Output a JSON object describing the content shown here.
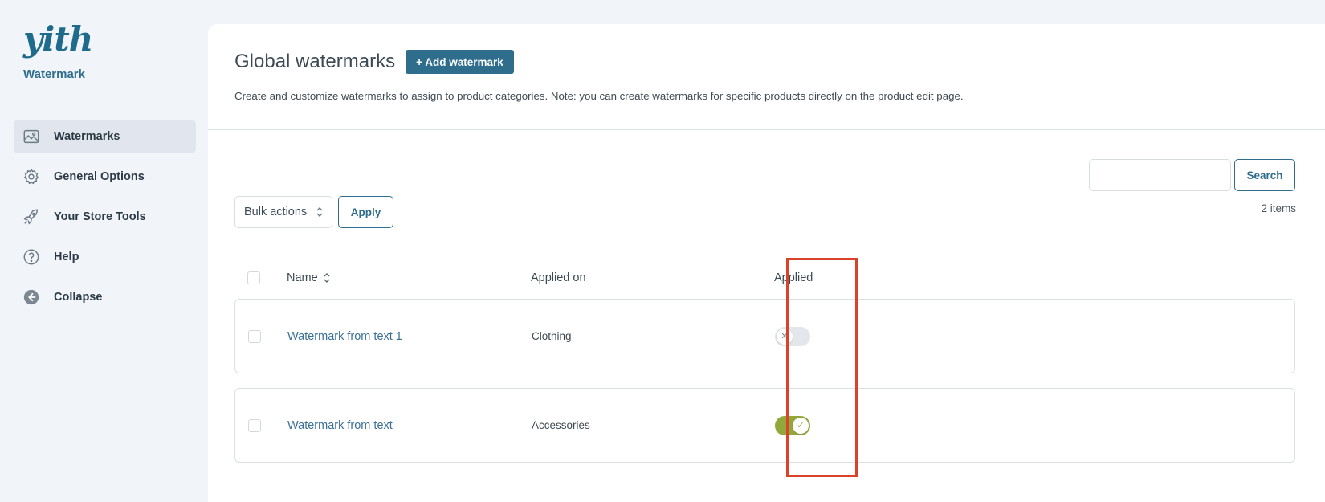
{
  "brand": {
    "logo_text": "yith",
    "subtitle": "Watermark"
  },
  "sidebar": {
    "items": [
      {
        "label": "Watermarks",
        "icon": "image-icon",
        "active": true
      },
      {
        "label": "General Options",
        "icon": "gear-icon",
        "active": false
      },
      {
        "label": "Your Store Tools",
        "icon": "rocket-icon",
        "active": false
      },
      {
        "label": "Help",
        "icon": "help-icon",
        "active": false
      },
      {
        "label": "Collapse",
        "icon": "collapse-icon",
        "active": false
      }
    ]
  },
  "header": {
    "title": "Global watermarks",
    "add_button": "+ Add watermark",
    "description": "Create and customize watermarks to assign to product categories. Note: you can create watermarks for specific products directly on the product edit page."
  },
  "search": {
    "value": "",
    "button": "Search"
  },
  "items_count": "2 items",
  "bulk": {
    "selected": "Bulk actions",
    "apply": "Apply"
  },
  "table": {
    "columns": {
      "name": "Name",
      "applied_on": "Applied on",
      "applied": "Applied"
    },
    "rows": [
      {
        "name": "Watermark from text 1",
        "applied_on": "Clothing",
        "applied": false
      },
      {
        "name": "Watermark from text",
        "applied_on": "Accessories",
        "applied": true
      }
    ]
  },
  "colors": {
    "accent": "#2e6d8c",
    "toggle_on": "#93a83b",
    "toggle_off": "#e3e7eb",
    "highlight": "#d9432a"
  }
}
